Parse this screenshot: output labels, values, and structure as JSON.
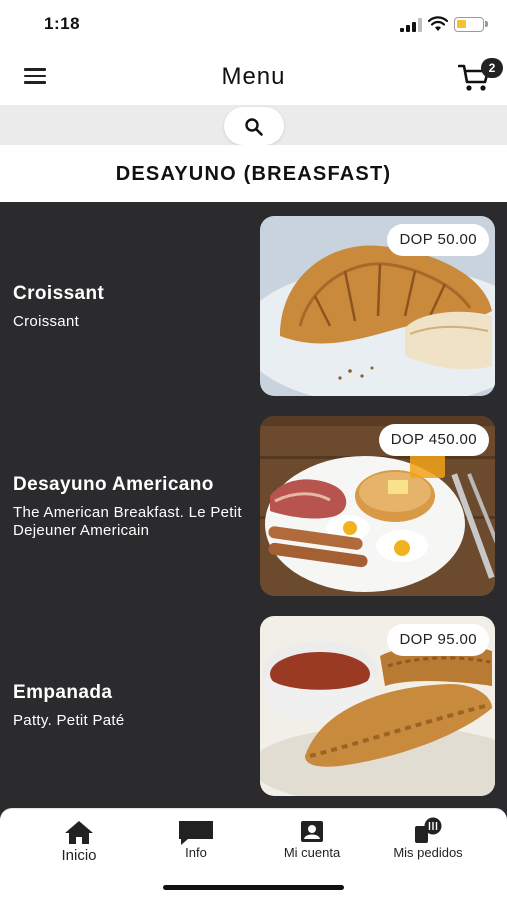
{
  "status_bar": {
    "time": "1:18"
  },
  "header": {
    "title": "Menu",
    "cart_count": "2"
  },
  "search": {
    "icon": "search-icon"
  },
  "category": {
    "title": "DESAYUNO (BREASFAST)"
  },
  "items": [
    {
      "name": "Croissant",
      "description": "Croissant",
      "price": "DOP 50.00"
    },
    {
      "name": "Desayuno Americano",
      "description": "The American Breakfast. Le Petit Dejeuner Americain",
      "price": "DOP 450.00"
    },
    {
      "name": "Empanada",
      "description": "Patty. Petit Paté",
      "price": "DOP 95.00"
    }
  ],
  "bottom_nav": [
    {
      "label": "Inicio",
      "icon": "home-icon"
    },
    {
      "label": "Info",
      "icon": "chat-icon"
    },
    {
      "label": "Mi cuenta",
      "icon": "account-icon"
    },
    {
      "label": "Mis pedidos",
      "icon": "orders-icon"
    }
  ],
  "colors": {
    "content_background": "#2b2b2e",
    "battery_fill": "#f4c430",
    "search_strip": "#ebebeb"
  }
}
